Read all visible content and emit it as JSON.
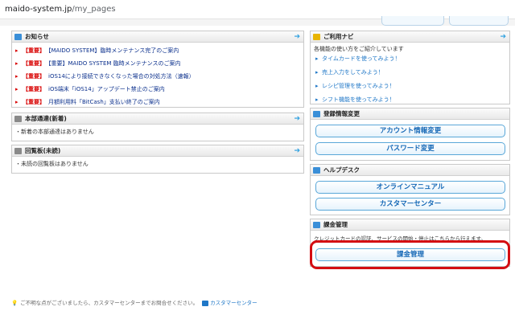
{
  "browser": {
    "url_host": "maido-system.jp",
    "url_path": "/my_pages"
  },
  "notices": {
    "title": "お知らせ",
    "items": [
      {
        "tag": "【重要】",
        "text": "【MAIDO SYSTEM】臨時メンテナンス完了のご案内"
      },
      {
        "tag": "【重要】",
        "text": "【重要】MAIDO SYSTEM 臨時メンテナンスのご案内"
      },
      {
        "tag": "【重要】",
        "text": "iOS14により接続できなくなった場合の対処方法（速報）"
      },
      {
        "tag": "【重要】",
        "text": "iOS端末「iOS14」アップデート禁止のご案内"
      },
      {
        "tag": "【重要】",
        "text": "月額利用料「BitCash」支払い終了のご案内"
      }
    ]
  },
  "hq_notice": {
    "title": "本部通達(新着)",
    "empty_text": "新着の本部通達はありません"
  },
  "circular": {
    "title": "回覧板(未読)",
    "empty_text": "未読の回覧板はありません"
  },
  "guide": {
    "title": "ご利用ナビ",
    "intro": "各機能の使い方をご紹介しています",
    "items": [
      "タイムカードを使ってみよう！",
      "売上入力をしてみよう！",
      "レシピ管理を使ってみよう！",
      "シフト機能を使ってみよう！"
    ]
  },
  "registration": {
    "title": "登録情報変更",
    "account_button": "アカウント情報変更",
    "password_button": "パスワード変更"
  },
  "helpdesk": {
    "title": "ヘルプデスク",
    "manual_button": "オンラインマニュアル",
    "support_button": "カスタマーセンター"
  },
  "billing": {
    "title": "課金管理",
    "description": "クレジットカードの認証、サービスの開始・停止はこちらから行えます。",
    "button": "課金管理"
  },
  "footer": {
    "text": "ご不明な点がございましたら、カスタマーセンターまでお問合せください。",
    "link": "カスタマーセンター"
  },
  "colors": {
    "accent_blue": "#1f77c7",
    "important_red": "#d80000",
    "highlight_red": "#d40d12"
  }
}
